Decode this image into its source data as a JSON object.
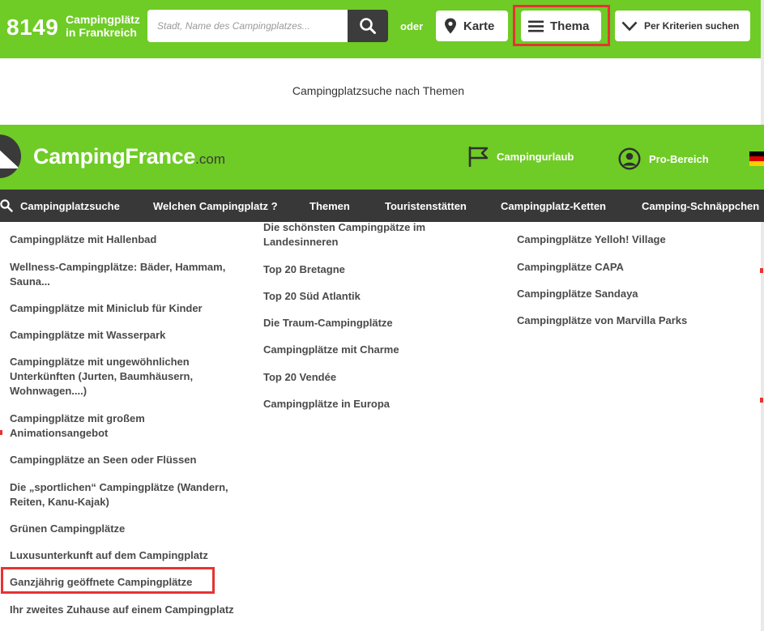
{
  "topbar": {
    "count": "8149",
    "count_label_line1": "Campingplätz",
    "count_label_line2": "in Frankreich",
    "search_placeholder": "Stadt, Name des Campingplatzes...",
    "oder": "oder",
    "karte_label": "Karte",
    "thema_label": "Thema",
    "kriterien_label": "Per Kriterien suchen"
  },
  "subheading": "Campingplatzsuche nach Themen",
  "header": {
    "logo_main": "CampingFrance",
    "logo_suffix": ".com",
    "campingurlaub": "Campingurlaub",
    "pro_bereich": "Pro-Bereich"
  },
  "nav": {
    "items": [
      "Campingplatzsuche",
      "Welchen Campingplatz ?",
      "Themen",
      "Touristenstätten",
      "Campingplatz-Ketten",
      "Camping-Schnäppchen"
    ]
  },
  "themes": {
    "col1": [
      "Campingplätze mit Hallenbad",
      "Wellness-Campingplätze: Bäder, Hammam, Sauna...",
      "Campingplätze mit Miniclub für Kinder",
      "Campingplätze mit Wasserpark",
      "Campingplätze mit ungewöhnlichen Unterkünften (Jurten, Baumhäusern, Wohnwagen....)",
      "Campingplätze mit großem Animationsangebot",
      "Campingplätze an Seen oder Flüssen",
      "Die „sportlichen“ Campingplätze (Wandern, Reiten, Kanu-Kajak)",
      "Grünen Campingplätze",
      "Luxusunterkunft auf dem Campingplatz",
      "Ganzjährig geöffnete Campingplätze",
      "Ihr zweites Zuhause auf einem Campingplatz"
    ],
    "col2": [
      "Die schönsten Campingpätze im Landesinneren",
      "Top 20 Bretagne",
      "Top 20 Süd Atlantik",
      "Die Traum-Campingplätze",
      "Campingplätze mit Charme",
      "Top 20 Vendée",
      "Campingplätze in Europa"
    ],
    "col3": [
      "Campingplätze Yelloh! Village",
      "Campingplätze CAPA",
      "Campingplätze Sandaya",
      "Campingplätze von Marvilla Parks"
    ]
  },
  "colors": {
    "brand_green": "#6fcb26",
    "nav_dark": "#383838",
    "highlight_red": "#e63333"
  },
  "icons": {
    "search": "search-icon",
    "karte": "map-pin-icon",
    "thema": "menu-icon",
    "kriterien": "chevron-down-icon",
    "urlaub": "flag-icon",
    "pro": "user-circle-icon",
    "language": "german-flag-icon"
  }
}
